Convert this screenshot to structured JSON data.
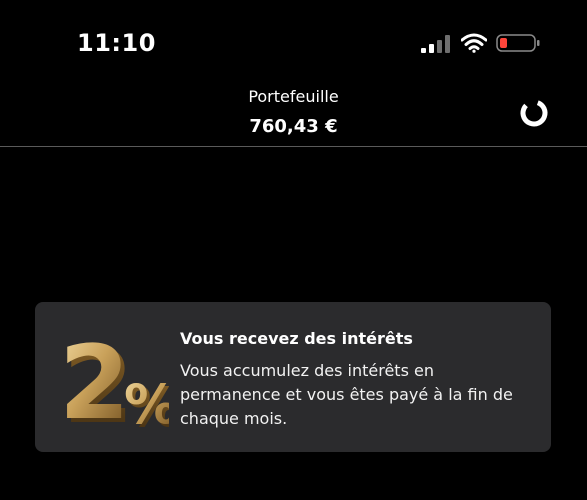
{
  "status_bar": {
    "time": "11:10",
    "signal_icon": "cellular-signal-icon",
    "wifi_icon": "wifi-icon",
    "battery_icon": "battery-low-icon",
    "battery_level": 0.15,
    "battery_color": "#ff453a"
  },
  "header": {
    "title": "Portefeuille",
    "balance": "760,43 €",
    "progress_icon": "circular-progress-icon"
  },
  "interest_card": {
    "graphic_text": "2%",
    "title": "Vous recevez des intérêts",
    "description": "Vous accumulez des intérêts en permanence et vous êtes payé à la fin de chaque mois.",
    "graphic_color": "#c9a15a"
  }
}
